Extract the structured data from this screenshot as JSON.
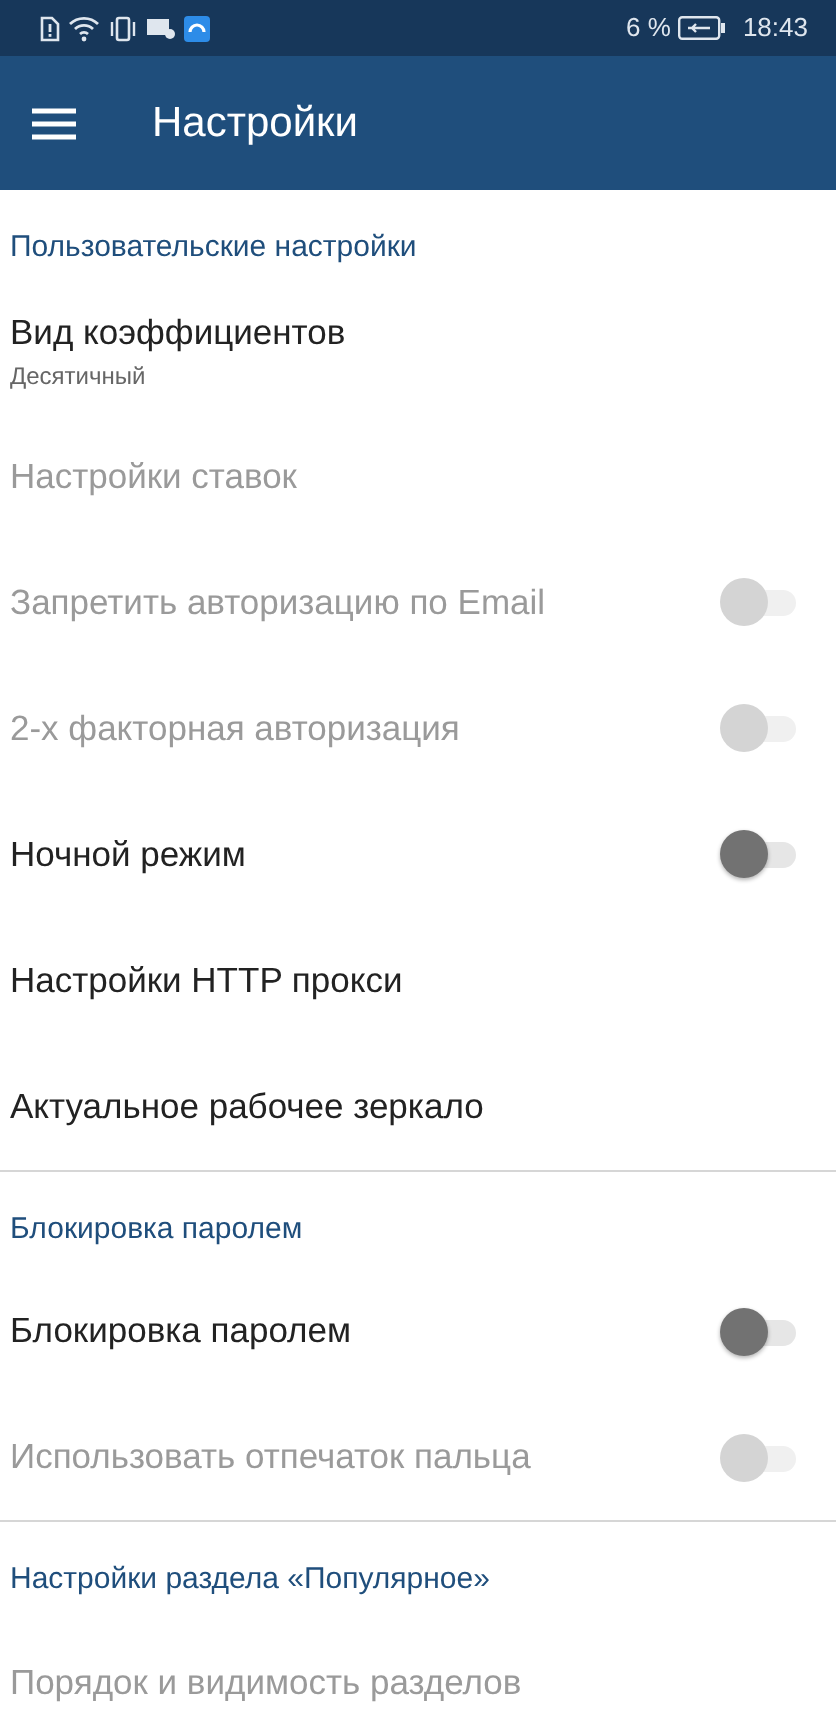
{
  "status_bar": {
    "battery_text": "6 %",
    "time": "18:43"
  },
  "app_bar": {
    "title": "Настройки"
  },
  "sections": [
    {
      "header": "Пользовательские настройки",
      "items": [
        {
          "kind": "text",
          "title": "Вид коэффициентов",
          "subtitle": "Десятичный",
          "disabled": false
        },
        {
          "kind": "text",
          "title": "Настройки ставок",
          "disabled": true
        },
        {
          "kind": "switch",
          "title": "Запретить авторизацию по Email",
          "disabled": true,
          "on": false
        },
        {
          "kind": "switch",
          "title": "2-х факторная авторизация",
          "disabled": true,
          "on": false
        },
        {
          "kind": "switch",
          "title": "Ночной режим",
          "disabled": false,
          "on": false
        },
        {
          "kind": "text",
          "title": "Настройки HTTP прокси",
          "disabled": false
        },
        {
          "kind": "text",
          "title": "Актуальное рабочее зеркало",
          "disabled": false
        }
      ]
    },
    {
      "header": "Блокировка паролем",
      "items": [
        {
          "kind": "switch",
          "title": "Блокировка паролем",
          "disabled": false,
          "on": false
        },
        {
          "kind": "switch",
          "title": "Использовать отпечаток пальца",
          "disabled": true,
          "on": false
        }
      ]
    },
    {
      "header": "Настройки раздела «Популярное»",
      "items": [
        {
          "kind": "text",
          "title": "Порядок и видимость разделов",
          "disabled": true
        }
      ]
    }
  ]
}
